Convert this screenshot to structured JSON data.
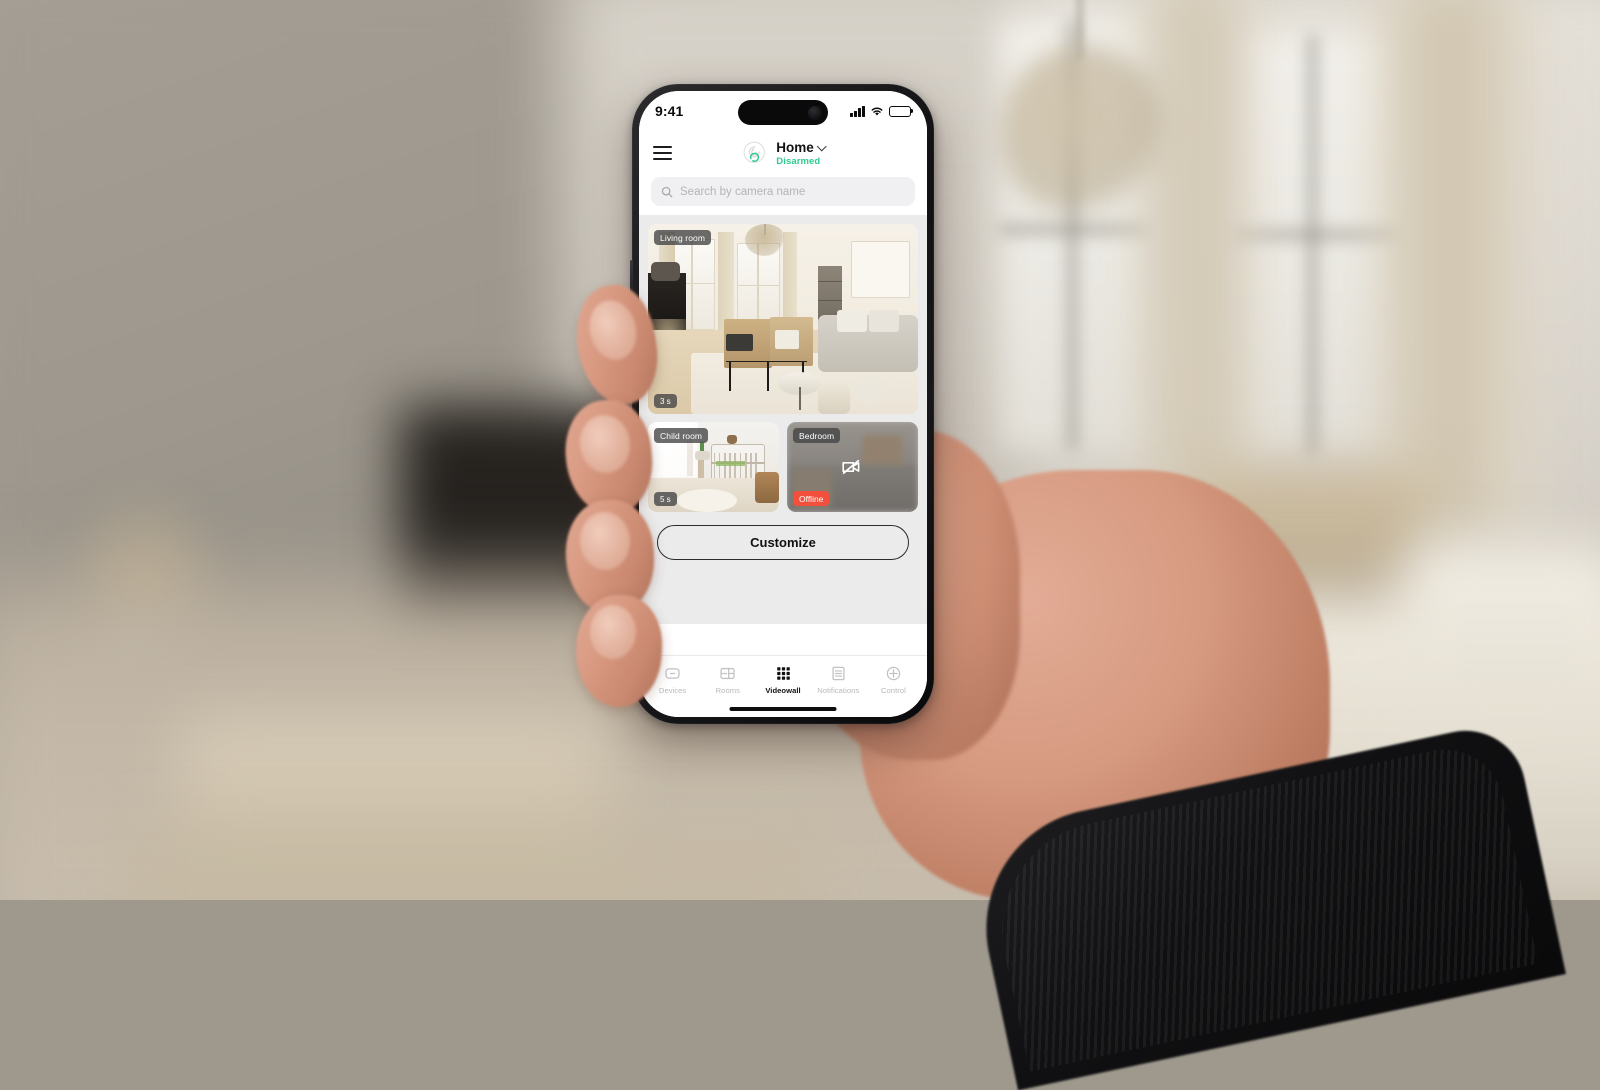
{
  "status_bar": {
    "time": "9:41",
    "cellular_icon": "signal-bars-icon",
    "wifi_icon": "wifi-icon",
    "battery_icon": "battery-full-icon"
  },
  "header": {
    "menu_icon": "hamburger-menu-icon",
    "logo_icon": "spiral-brand-logo-icon",
    "home_title": "Home",
    "chevron_icon": "chevron-down-icon",
    "armed_status": "Disarmed",
    "armed_status_color": "#2ECB8F"
  },
  "search": {
    "icon": "search-icon",
    "placeholder": "Search by camera name",
    "value": ""
  },
  "videowall": {
    "cameras": [
      {
        "name": "Living room",
        "badge": "3 s",
        "state": "online",
        "size": "large"
      },
      {
        "name": "Child room",
        "badge": "5 s",
        "state": "online",
        "size": "small"
      },
      {
        "name": "Bedroom",
        "badge": "Offline",
        "state": "offline",
        "offline_icon": "camera-off-icon",
        "badge_color": "#F2503C",
        "size": "small"
      }
    ],
    "customize_label": "Customize"
  },
  "tabbar": {
    "items": [
      {
        "label": "Devices",
        "icon": "device-minus-icon",
        "active": false
      },
      {
        "label": "Rooms",
        "icon": "rooms-layout-icon",
        "active": false
      },
      {
        "label": "Videowall",
        "icon": "grid-videowall-icon",
        "active": true
      },
      {
        "label": "Notifications",
        "icon": "list-document-icon",
        "active": false
      },
      {
        "label": "Control",
        "icon": "plus-circle-icon",
        "active": false
      }
    ]
  }
}
